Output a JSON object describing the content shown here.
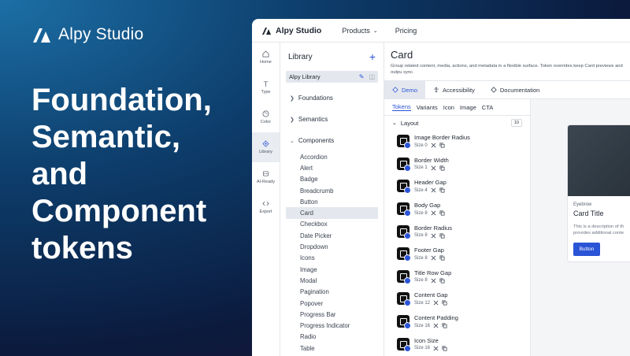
{
  "promo": {
    "brand": "Alpy Studio",
    "headline": [
      "Foundation,",
      "Semantic,",
      "and",
      "Component",
      "tokens"
    ]
  },
  "topbar": {
    "brand": "Alpy Studio",
    "links": [
      "Products",
      "Pricing"
    ]
  },
  "rail": [
    {
      "label": "Home",
      "icon": "home-icon"
    },
    {
      "label": "Type",
      "icon": "type-icon"
    },
    {
      "label": "Color",
      "icon": "palette-icon"
    },
    {
      "label": "Library",
      "icon": "library-icon",
      "active": true
    },
    {
      "label": "AI-Ready",
      "icon": "ai-icon"
    },
    {
      "label": "Export",
      "icon": "code-icon"
    }
  ],
  "library": {
    "title": "Library",
    "selected": "Alpy Library",
    "groups": [
      "Foundations",
      "Semantics",
      "Components"
    ],
    "components": [
      "Accordion",
      "Alert",
      "Badge",
      "Breadcrumb",
      "Button",
      "Card",
      "Checkbox",
      "Date Picker",
      "Dropdown",
      "Icons",
      "Image",
      "Modal",
      "Pagination",
      "Popover",
      "Progress Bar",
      "Progress Indicator",
      "Radio",
      "Table"
    ],
    "active_component": "Card"
  },
  "main": {
    "title": "Card",
    "description": "Group related content, media, actions, and metadata in a flexible surface. Token overrides keep Card previews and outpu sync.",
    "tabs": [
      "Demo",
      "Accessibility",
      "Documentation"
    ],
    "subtabs": [
      "Tokens",
      "Variants",
      "Icon",
      "Image",
      "CTA"
    ],
    "section": "Layout",
    "section_count": "10",
    "tokens": [
      {
        "name": "Image Border Radius",
        "size": "Size 0"
      },
      {
        "name": "Border Width",
        "size": "Size 1"
      },
      {
        "name": "Header Gap",
        "size": "Size 4"
      },
      {
        "name": "Body Gap",
        "size": "Size 8"
      },
      {
        "name": "Border Radius",
        "size": "Size 8"
      },
      {
        "name": "Footer Gap",
        "size": "Size 8"
      },
      {
        "name": "Title Row Gap",
        "size": "Size 8"
      },
      {
        "name": "Content Gap",
        "size": "Size 12"
      },
      {
        "name": "Content Padding",
        "size": "Size 16"
      },
      {
        "name": "Icon Size",
        "size": "Size 16"
      }
    ]
  },
  "preview": {
    "eyebrow": "Eyebrow",
    "title": "Card Title",
    "text_line1": "This is a description of th",
    "text_line2": "provides additional conte",
    "button": "Button"
  },
  "colors": {
    "accent": "#2a54d6"
  }
}
